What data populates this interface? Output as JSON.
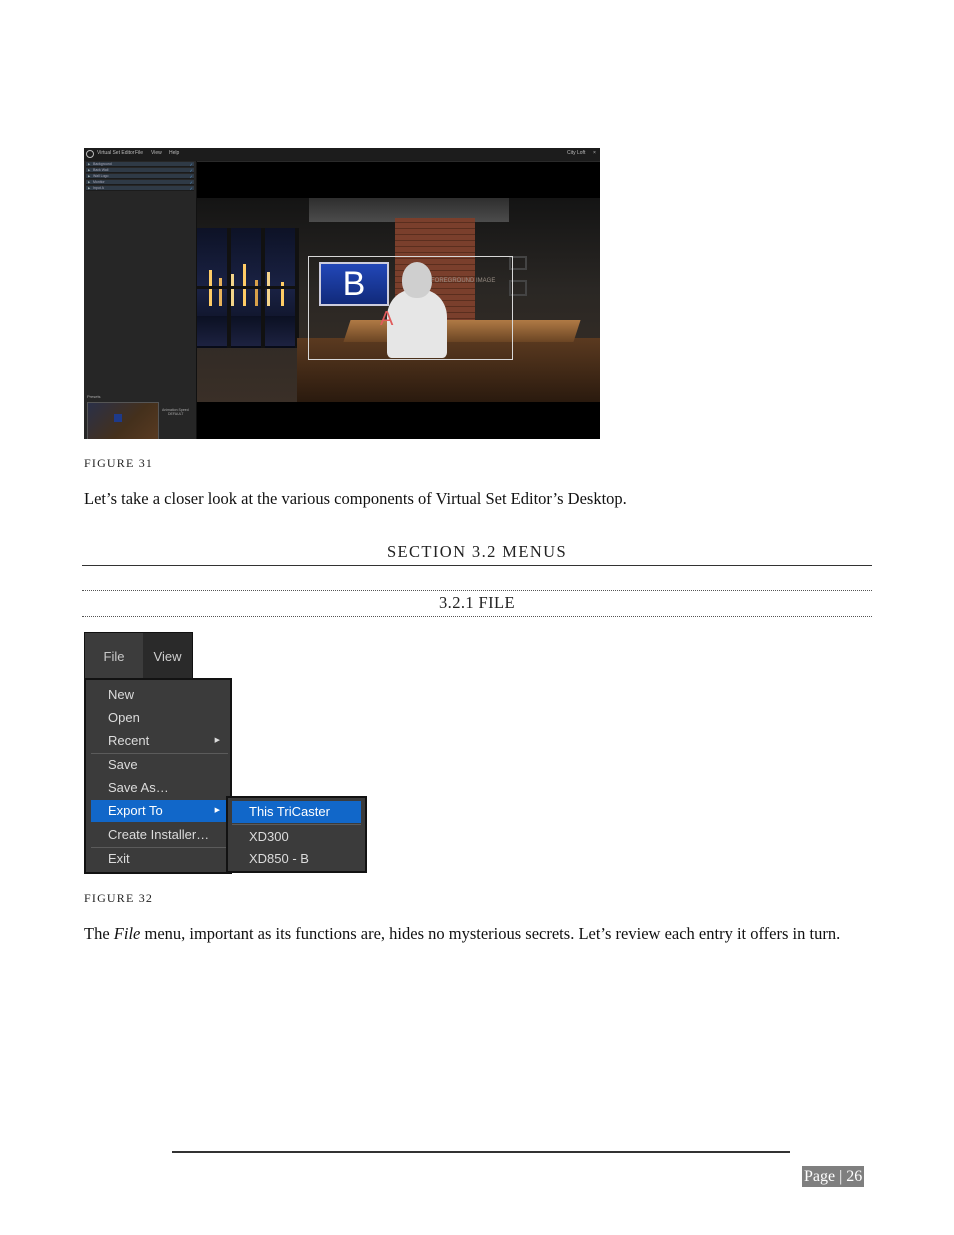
{
  "figure31": {
    "caption": "FIGURE 31",
    "screenshot": {
      "window_title": "Virtual Set Editor",
      "menu": [
        "File",
        "View",
        "Help"
      ],
      "set_name": "City Loft",
      "close_glyph": "×",
      "panel_rows": [
        "Background",
        "Back Wall",
        "Wall Logo",
        "Monitor",
        "Input A"
      ],
      "presets_label": "Presets",
      "preset_info_line1": "Animation Speed",
      "preset_info_line2": "DEFAULT",
      "slot_b": "B",
      "slot_a": "A",
      "fg_label": "FOREGROUND IMAGE"
    }
  },
  "intro_paragraph": "Let’s take a closer look at the various components of Virtual Set Editor’s Desktop.",
  "section": {
    "heading": "SECTION 3.2 MENUS",
    "subheading": "3.2.1 FILE"
  },
  "figure32": {
    "caption": "FIGURE 32",
    "menubar": {
      "file": "File",
      "view": "View"
    },
    "file_menu": {
      "items": [
        "New",
        "Open",
        "Recent",
        "Save",
        "Save As…",
        "Export To",
        "Create Installer…",
        "Exit"
      ],
      "active_item": "Export To",
      "submenu_arrow": "▶"
    },
    "export_submenu": {
      "items": [
        "This TriCaster",
        "XD300",
        "XD850 - B"
      ],
      "active_item": "This TriCaster"
    },
    "colors": {
      "highlight": "#1167c9",
      "menu_bg": "#3b3b3b"
    }
  },
  "paragraph2": {
    "before": "The ",
    "emphasis": "File",
    "after": " menu, important as its functions are, hides no mysterious secrets.  Let’s review each entry it offers in turn."
  },
  "footer": {
    "page_label": "Page | 26"
  }
}
